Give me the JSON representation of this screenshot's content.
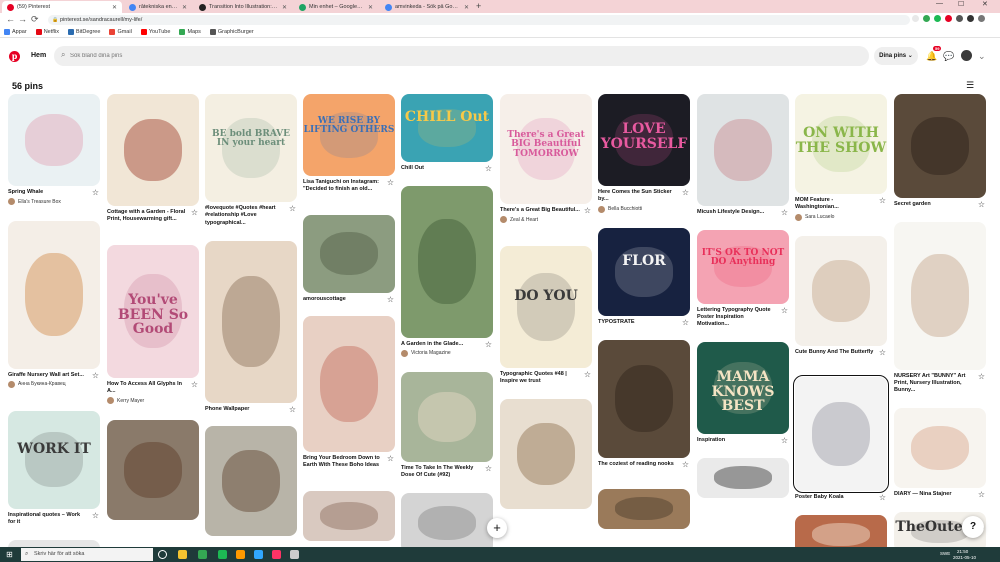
{
  "browser": {
    "tabs": [
      {
        "label": "(59) Pinterest",
        "color": "#e60023"
      },
      {
        "label": "råtekniska engelska - Sök på Google",
        "color": "#4285f4"
      },
      {
        "label": "Transition Into Illustration: Tr...",
        "color": "#222222"
      },
      {
        "label": "Min enhet – Google Drive",
        "color": "#1fa463"
      },
      {
        "label": "amvinkeda - Sök på Google",
        "color": "#4285f4"
      }
    ],
    "newtab_icon": "+",
    "url": "pinterest.se/sandracaurell/my-life/",
    "back_icon": "←",
    "forward_icon": "→",
    "reload_icon": "⟳",
    "lock_icon": "🔒",
    "minimize_icon": "—",
    "maximize_icon": "☐",
    "close_icon": "✕",
    "bookmarks": [
      {
        "label": "Appar",
        "color": "#4285f4"
      },
      {
        "label": "Netflix",
        "color": "#e50914"
      },
      {
        "label": "BitDegree",
        "color": "#2b6cb0"
      },
      {
        "label": "Gmail",
        "color": "#ea4335"
      },
      {
        "label": "YouTube",
        "color": "#ff0000"
      },
      {
        "label": "Maps",
        "color": "#34a853"
      },
      {
        "label": "GraphicBurger",
        "color": "#555555"
      }
    ]
  },
  "header": {
    "logo_letter": "p",
    "home_label": "Hem",
    "search_placeholder": "Sök bland dina pins",
    "search_icon": "⌕",
    "profile_menu_label": "Dina pins ⌄",
    "notification_icon": "🔔",
    "notification_count": "59",
    "messages_icon": "💬",
    "chevron_icon": "⌄",
    "brand_color": "#e60023"
  },
  "board": {
    "pin_count": "56 pins",
    "filter_icon": "☰"
  },
  "pins": [
    {
      "title": "Spring Whale",
      "author": "Ella's Treasure Box",
      "bg": "#eaf1f3",
      "art": "",
      "art_color": "#e3a3b6"
    },
    {
      "title": "Giraffe Nursery Wall art Set...",
      "author": "Анна Букина-Кравец",
      "bg": "#f4eee7",
      "art": "",
      "art_color": "#d08a4a"
    },
    {
      "title": "Inspirational quotes – Work for it",
      "author": "",
      "bg": "#d6e8e2",
      "art": "WORK IT",
      "art_color": "#3a3a3a"
    },
    {
      "title": "",
      "author": "",
      "bg": "#e6e6e6",
      "art": "",
      "art_color": "#999999"
    },
    {
      "title": "Cottage with a Garden - Floral Print, Housewarming gift...",
      "author": "",
      "bg": "#f1e6d6",
      "art": "",
      "art_color": "#9e3b2b"
    },
    {
      "title": "How To Access All Glyphs In A...",
      "author": "Kerry Mayer",
      "bg": "#f3d9df",
      "art": "You've BEEN So Good",
      "art_color": "#b24a76"
    },
    {
      "title": "",
      "author": "",
      "bg": "#8a7a6a",
      "art": "",
      "art_color": "#5b3a26"
    },
    {
      "title": "#lovequote #Quotes #heart #relationship #Love typographical...",
      "author": "",
      "bg": "#f4efe2",
      "art": "BE bold BRAVE IN your heart",
      "art_color": "#6c8e7a"
    },
    {
      "title": "Phone Wallpaper",
      "author": "",
      "bg": "#e7d7c6",
      "art": "",
      "art_color": "#8a6e57"
    },
    {
      "title": "",
      "author": "",
      "bg": "#b8b4a8",
      "art": "",
      "art_color": "#5a3e2a"
    },
    {
      "title": "Lisa Taniguchi on Instagram: \"Decided to finish an old...",
      "author": "",
      "bg": "#f4a46a",
      "art": "WE RISE BY LIFTING OTHERS",
      "art_color": "#3b6fb6"
    },
    {
      "title": "amorouscottage",
      "author": "",
      "bg": "#8c9c80",
      "art": "",
      "art_color": "#4f5e45"
    },
    {
      "title": "Bring Your Bedroom Down to Earth With These Boho Ideas",
      "author": "",
      "bg": "#e8d0c4",
      "art": "",
      "art_color": "#c46a5a"
    },
    {
      "title": "",
      "author": "",
      "bg": "#d9c9c0",
      "art": "",
      "art_color": "#8a6a5a"
    },
    {
      "title": "Chill Out",
      "author": "",
      "bg": "#3aa3b3",
      "art": "CHILL Out",
      "art_color": "#f7c948"
    },
    {
      "title": "A Garden in the Glade...",
      "author": "Victoria Magazine",
      "bg": "#7e9a6c",
      "art": "",
      "art_color": "#3f5a35"
    },
    {
      "title": "Time To Take In The Weekly Dose Of Cute (#92)",
      "author": "",
      "bg": "#a8b59a",
      "art": "",
      "art_color": "#e8dcc8"
    },
    {
      "title": "",
      "author": "",
      "bg": "#d4d4d4",
      "art": "",
      "art_color": "#888888"
    },
    {
      "title": "There's a Great Big Beautiful...",
      "author": "Zeal & Heart",
      "bg": "#f6efe9",
      "art": "There's a Great BIG Beautiful TOMORROW",
      "art_color": "#d85a9b"
    },
    {
      "title": "Typographic Quotes #48 | Inspire we trust",
      "author": "",
      "bg": "#f4ecd6",
      "art": "DO YOU",
      "art_color": "#3a3a3a"
    },
    {
      "title": "",
      "author": "",
      "bg": "#e8ded0",
      "art": "",
      "art_color": "#8e6e4e"
    },
    {
      "title": "Here Comes the Sun Sticker by...",
      "author": "Bella Bucchiotti",
      "bg": "#1c1c24",
      "art": "LOVE YOURSELF",
      "art_color": "#e85aa0"
    },
    {
      "title": "TYPOSTRATE",
      "author": "",
      "bg": "#172240",
      "art": "FLOR",
      "art_color": "#f4f4f4"
    },
    {
      "title": "The coziest of reading nooks",
      "author": "",
      "bg": "#5a4a3a",
      "art": "",
      "art_color": "#2e241a"
    },
    {
      "title": "",
      "author": "",
      "bg": "#9a7a5a",
      "art": "",
      "art_color": "#4a3a2a"
    },
    {
      "title": "Micush Lifestyle Design...",
      "author": "",
      "bg": "#dfe3e4",
      "art": "",
      "art_color": "#c9888f"
    },
    {
      "title": "Lettering Typography Quote Poster Inspiration Motivation...",
      "author": "",
      "bg": "#f4a3b3",
      "art": "IT'S OK TO NOT DO Anything",
      "art_color": "#e8305a"
    },
    {
      "title": "Inspiration",
      "author": "",
      "bg": "#1f5a4a",
      "art": "MAMA KNOWS BEST",
      "art_color": "#f4e4c4"
    },
    {
      "title": "",
      "author": "",
      "bg": "#eaeaea",
      "art": "",
      "art_color": "#333333"
    },
    {
      "title": "MOM Feature - Washingtonian...",
      "author": "Sara Lucaelo",
      "bg": "#f5f3e3",
      "art": "ON WITH THE SHOW",
      "art_color": "#8ab64a"
    },
    {
      "title": "Cute Bunny And The Butterfly",
      "author": "",
      "bg": "#f4f0ea",
      "art": "",
      "art_color": "#c4a48a"
    },
    {
      "title": "Poster Baby Koala",
      "author": "",
      "bg": "#f3f3f3",
      "art": "",
      "art_color": "#9a9aa4"
    },
    {
      "title": "",
      "author": "",
      "bg": "#b86a4a",
      "art": "",
      "art_color": "#f4e4d4"
    },
    {
      "title": "Secret garden",
      "author": "",
      "bg": "#5a4a3a",
      "art": "",
      "art_color": "#2a2018"
    },
    {
      "title": "NURSERY Art \"BUNNY\" Art Print, Nursery Illustration, Bunny...",
      "author": "",
      "bg": "#f7f6f2",
      "art": "",
      "art_color": "#c4a48a"
    },
    {
      "title": "DIARY — Nina Stajner",
      "author": "",
      "bg": "#f7f4ef",
      "art": "",
      "art_color": "#d8a48a"
    },
    {
      "title": "",
      "author": "",
      "bg": "#f3f0ea",
      "art": "TheOuterio",
      "art_color": "#333333"
    }
  ],
  "fab_icon": "+",
  "help_icon": "?",
  "star_icon": "☆",
  "taskbar": {
    "start_icon": "⊞",
    "search_placeholder": "Skriv här för att söka",
    "search_icon": "⌕",
    "time": "21:50",
    "date": "2021-05-10",
    "lang": "SWE",
    "apps": [
      {
        "name": "task-view",
        "color": "#ffffff"
      },
      {
        "name": "file-explorer",
        "color": "#f4c430"
      },
      {
        "name": "chrome",
        "color": "#34a853"
      },
      {
        "name": "spotify",
        "color": "#1db954"
      },
      {
        "name": "illustrator",
        "color": "#ff9a00"
      },
      {
        "name": "photoshop",
        "color": "#31a8ff"
      },
      {
        "name": "indesign",
        "color": "#ff3366"
      },
      {
        "name": "other",
        "color": "#cccccc"
      }
    ]
  }
}
